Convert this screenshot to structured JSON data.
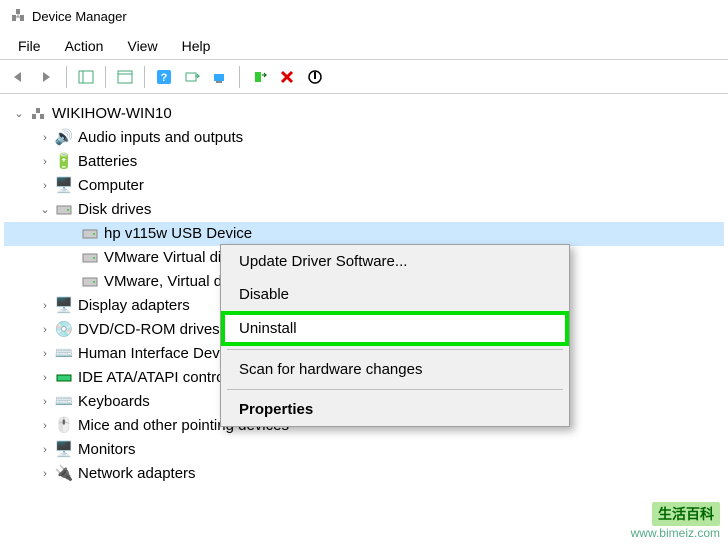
{
  "window": {
    "title": "Device Manager"
  },
  "menu": {
    "file": "File",
    "action": "Action",
    "view": "View",
    "help": "Help"
  },
  "tree": {
    "root": "WIKIHOW-WIN10",
    "audio": "Audio inputs and outputs",
    "batteries": "Batteries",
    "computer": "Computer",
    "disk_drives": "Disk drives",
    "disk_child_0": "hp v115w USB Device",
    "disk_child_1": "VMware Virtual disk",
    "disk_child_2": "VMware, Virtual disk",
    "display": "Display adapters",
    "dvd": "DVD/CD-ROM drives",
    "hid": "Human Interface Devices",
    "ide": "IDE ATA/ATAPI controllers",
    "keyboards": "Keyboards",
    "mice": "Mice and other pointing devices",
    "monitors": "Monitors",
    "network": "Network adapters"
  },
  "context": {
    "update": "Update Driver Software...",
    "disable": "Disable",
    "uninstall": "Uninstall",
    "scan": "Scan for hardware changes",
    "properties": "Properties"
  },
  "watermark": {
    "label": "生活百科",
    "url": "www.bimeiz.com"
  }
}
